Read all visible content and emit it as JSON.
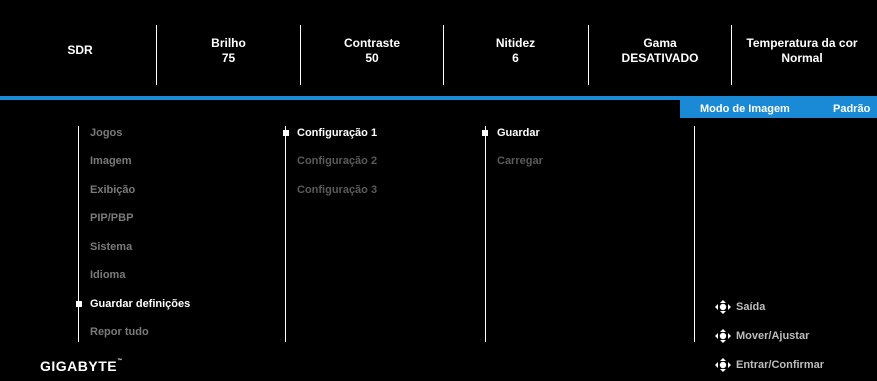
{
  "status": {
    "mode": "SDR",
    "brightness_label": "Brilho",
    "brightness_value": "75",
    "contrast_label": "Contraste",
    "contrast_value": "50",
    "sharpness_label": "Nitidez",
    "sharpness_value": "6",
    "gamma_label": "Gama",
    "gamma_value": "DESATIVADO",
    "color_temp_label": "Temperatura da cor",
    "color_temp_value": "Normal"
  },
  "mode_tab": {
    "label": "Modo de Imagem",
    "value": "Padrão"
  },
  "main_menu": [
    "Jogos",
    "Imagem",
    "Exibição",
    "PIP/PBP",
    "Sistema",
    "Idioma",
    "Guardar definições",
    "Repor tudo"
  ],
  "main_menu_selected": "Guardar definições",
  "config_menu": [
    "Configuração 1",
    "Configuração 2",
    "Configuração 3"
  ],
  "config_menu_selected": "Configuração 1",
  "action_menu": [
    "Guardar",
    "Carregar"
  ],
  "action_menu_selected": "Guardar",
  "brand": "GIGABYTE",
  "hints": [
    {
      "icon": "joystick-icon",
      "label": "Saída"
    },
    {
      "icon": "joystick-icon",
      "label": "Mover/Ajustar"
    },
    {
      "icon": "joystick-icon",
      "label": "Entrar/Confirmar"
    }
  ],
  "colors": {
    "accent": "#1b8ad6",
    "inactive_text": "#7a7a7a",
    "background": "#000000"
  }
}
